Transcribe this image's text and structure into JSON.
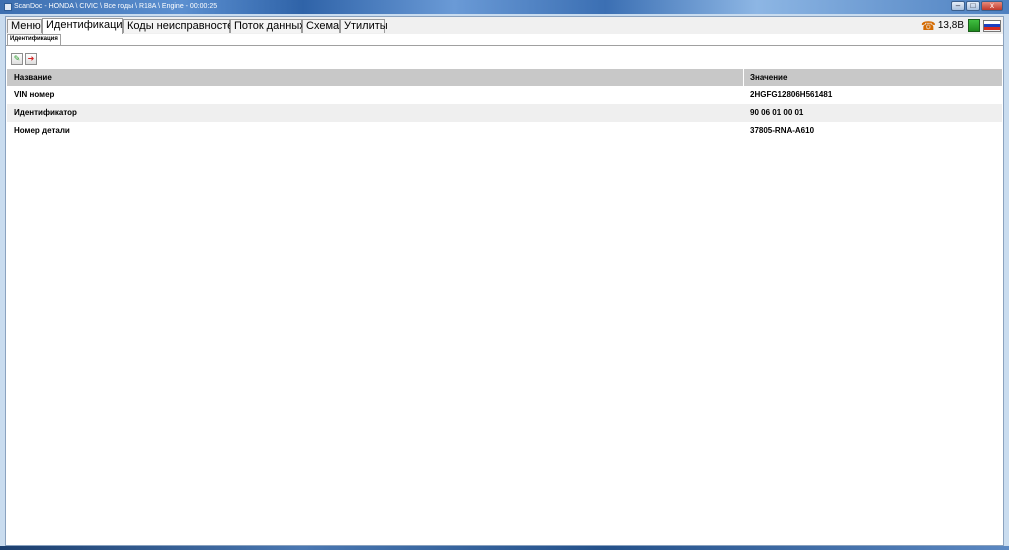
{
  "window": {
    "title": "ScanDoc - HONDA \\ CIVIC \\ Все годы \\ R18A \\ Engine - 00:00:25",
    "controls": {
      "minimize": "–",
      "maximize": "□",
      "close": "x"
    }
  },
  "menu": {
    "tabs": [
      {
        "label": "Меню"
      },
      {
        "label": "Идентификация",
        "active": true
      },
      {
        "label": "Коды неисправностей"
      },
      {
        "label": "Поток данных"
      },
      {
        "label": "Схема"
      },
      {
        "label": "Утилиты"
      }
    ]
  },
  "status": {
    "phone_icon": "phone-icon",
    "voltage": "13,8В",
    "connection_icon": "plug-icon",
    "language_icon": "russia-flag-icon",
    "colors": {
      "phone": "#d46a00",
      "flag": [
        "#ffffff",
        "#1c3fbf",
        "#d52b1e"
      ]
    }
  },
  "subtabs": [
    {
      "label": "Идентификация"
    }
  ],
  "toolbar": {
    "buttons": [
      {
        "icon": "edit-icon",
        "glyph": "✎"
      },
      {
        "icon": "exit-icon",
        "glyph": "➜"
      }
    ]
  },
  "table": {
    "headers": {
      "name": "Название",
      "value": "Значение"
    },
    "rows": [
      {
        "name": "VIN номер",
        "value": "2HGFG12806H561481"
      },
      {
        "name": "Идентификатор",
        "value": "90 06 01 00 01"
      },
      {
        "name": "Номер детали",
        "value": "37805-RNA-A610"
      }
    ]
  }
}
